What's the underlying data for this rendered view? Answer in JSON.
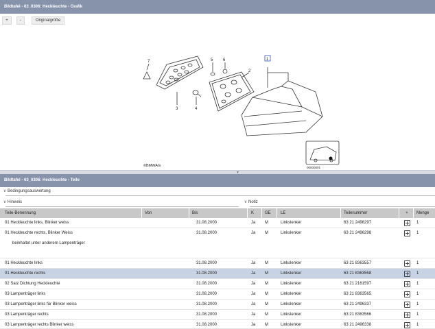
{
  "top_panel": {
    "title": "Bildtafel - 63_0306: Heckleuchte - Grafik"
  },
  "toolbar": {
    "zoom_in_label": "+",
    "zoom_out_label": "-",
    "original_size_label": "Originalgröße"
  },
  "diagram": {
    "callouts": [
      "7",
      "5",
      "6",
      "1",
      "2",
      "3",
      "4"
    ],
    "copyright": "©BMWAG",
    "image_number": "00000001"
  },
  "bottom_panel": {
    "title": "Bildtafel - 63_0306: Heckleuchte - Teile"
  },
  "sections": {
    "bedingungen": "Bedingungsauswertung",
    "hinweis": "Hinweis",
    "notiz": "Notiz"
  },
  "table": {
    "headers": {
      "name": "Teile-Benennung",
      "von": "Von",
      "bis": "Bis",
      "k": "K",
      "ge": "GE",
      "le": "LE",
      "teilenummer": "Teilenummer",
      "plus": "+",
      "menge": "Menge"
    },
    "rows": [
      {
        "name": "01 Heckleuchte links, Blinker weiss",
        "von": "",
        "bis": "31.08.2000",
        "k": "Ja",
        "ge": "M",
        "le": "Linkslenker",
        "teilenummer": "63 21 2496297",
        "menge": "1"
      },
      {
        "name": "01 Heckleuchte rechts, Blinker Weiss",
        "von": "",
        "bis": "31.08.2000",
        "k": "Ja",
        "ge": "M",
        "le": "Linkslenker",
        "teilenummer": "63 21 2496298",
        "menge": "1"
      },
      {
        "name": "01 Heckleuchte links",
        "von": "",
        "bis": "31.08.2000",
        "k": "Ja",
        "ge": "M",
        "le": "Linkslenker",
        "teilenummer": "63 21 8363557",
        "menge": "1"
      },
      {
        "name": "01 Heckleuchte rechts",
        "von": "",
        "bis": "31.08.2000",
        "k": "Ja",
        "ge": "M",
        "le": "Linkslenker",
        "teilenummer": "63 21 8363558",
        "menge": "1"
      },
      {
        "name": "02 Satz Dichtung Heckleuchte",
        "von": "",
        "bis": "31.08.2000",
        "k": "Ja",
        "ge": "M",
        "le": "Linkslenker",
        "teilenummer": "63 21 2161597",
        "menge": "1"
      },
      {
        "name": "03 Lampenträger links",
        "von": "",
        "bis": "31.08.2000",
        "k": "Ja",
        "ge": "M",
        "le": "Linkslenker",
        "teilenummer": "63 21 8363565",
        "menge": "1"
      },
      {
        "name": "03 Lampenträger links für Blinker weiss",
        "von": "",
        "bis": "31.08.2000",
        "k": "Ja",
        "ge": "M",
        "le": "Linkslenker",
        "teilenummer": "63 21 2496337",
        "menge": "1"
      },
      {
        "name": "03 Lampenträger rechts",
        "von": "",
        "bis": "31.08.2000",
        "k": "Ja",
        "ge": "M",
        "le": "Linkslenker",
        "teilenummer": "63 21 8363566",
        "menge": "1"
      },
      {
        "name": "03 Lampenträger rechts Blinker weiss",
        "von": "",
        "bis": "31.08.2000",
        "k": "Ja",
        "ge": "M",
        "le": "Linkslenker",
        "teilenummer": "63 21 2496338",
        "menge": "1"
      }
    ],
    "note": "beinhaltet unter anderem Lampenträger"
  },
  "colors": {
    "titlebar": "#8792ab",
    "header_row": "#c8c8c8",
    "selected_row": "#c7d3e4"
  }
}
